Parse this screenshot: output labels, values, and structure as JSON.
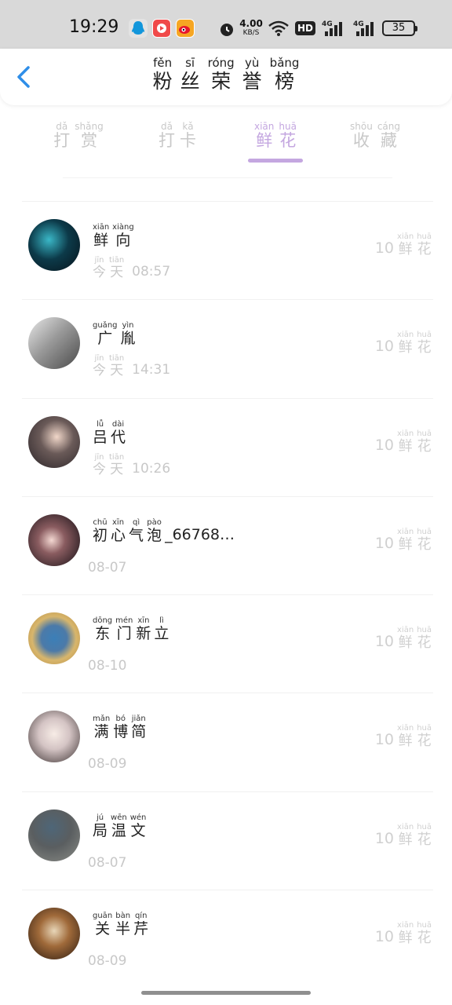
{
  "status_bar": {
    "time": "19:29",
    "network_speed": "4.00",
    "network_speed_unit": "KB/S",
    "hd_label": "HD",
    "signal1_label": "4G",
    "signal2_label": "4G",
    "battery": "35",
    "apps": [
      "qq-icon",
      "video-app-icon",
      "weibo-icon"
    ]
  },
  "header": {
    "title": [
      {
        "py": "fěn",
        "hz": "粉"
      },
      {
        "py": "sī",
        "hz": "丝"
      },
      {
        "py": "róng",
        "hz": "荣"
      },
      {
        "py": "yù",
        "hz": "誉"
      },
      {
        "py": "bǎng",
        "hz": "榜"
      }
    ]
  },
  "tabs": [
    {
      "chars": [
        {
          "py": "dǎ",
          "hz": "打"
        },
        {
          "py": "shǎng",
          "hz": "赏"
        }
      ],
      "active": false
    },
    {
      "chars": [
        {
          "py": "dǎ",
          "hz": "打"
        },
        {
          "py": "kǎ",
          "hz": "卡"
        }
      ],
      "active": false
    },
    {
      "chars": [
        {
          "py": "xiān",
          "hz": "鲜"
        },
        {
          "py": "huā",
          "hz": "花"
        }
      ],
      "active": true
    },
    {
      "chars": [
        {
          "py": "shōu",
          "hz": "收"
        },
        {
          "py": "cáng",
          "hz": "藏"
        }
      ],
      "active": false
    }
  ],
  "colors": {
    "accent": "#c4a7e0",
    "muted_text": "#c8c8c8",
    "back_arrow": "#2f8ee8"
  },
  "gift": {
    "count": "10",
    "chars": [
      {
        "py": "xiān",
        "hz": "鲜"
      },
      {
        "py": "huā",
        "hz": "花"
      }
    ]
  },
  "today_label": [
    {
      "py": "jīn",
      "hz": "今"
    },
    {
      "py": "tiān",
      "hz": "天"
    }
  ],
  "fans": [
    {
      "name": [
        {
          "py": "xiān",
          "hz": "鲜"
        },
        {
          "py": "xiàng",
          "hz": "向"
        }
      ],
      "suffix": "",
      "today": true,
      "time": "08:57"
    },
    {
      "name": [
        {
          "py": "guǎng",
          "hz": "广"
        },
        {
          "py": "yìn",
          "hz": "胤"
        }
      ],
      "suffix": "",
      "today": true,
      "time": "14:31"
    },
    {
      "name": [
        {
          "py": "lǚ",
          "hz": "吕"
        },
        {
          "py": "dài",
          "hz": "代"
        }
      ],
      "suffix": "",
      "today": true,
      "time": "10:26"
    },
    {
      "name": [
        {
          "py": "chū",
          "hz": "初"
        },
        {
          "py": "xīn",
          "hz": "心"
        },
        {
          "py": "qì",
          "hz": "气"
        },
        {
          "py": "pào",
          "hz": "泡"
        }
      ],
      "suffix": "_66768…",
      "today": false,
      "time": "08-07"
    },
    {
      "name": [
        {
          "py": "dōng",
          "hz": "东"
        },
        {
          "py": "mén",
          "hz": "门"
        },
        {
          "py": "xīn",
          "hz": "新"
        },
        {
          "py": "lì",
          "hz": "立"
        }
      ],
      "suffix": "",
      "today": false,
      "time": "08-10"
    },
    {
      "name": [
        {
          "py": "mǎn",
          "hz": "满"
        },
        {
          "py": "bó",
          "hz": "博"
        },
        {
          "py": "jiǎn",
          "hz": "简"
        }
      ],
      "suffix": "",
      "today": false,
      "time": "08-09"
    },
    {
      "name": [
        {
          "py": "jú",
          "hz": "局"
        },
        {
          "py": "wēn",
          "hz": "温"
        },
        {
          "py": "wén",
          "hz": "文"
        }
      ],
      "suffix": "",
      "today": false,
      "time": "08-07"
    },
    {
      "name": [
        {
          "py": "guān",
          "hz": "关"
        },
        {
          "py": "bàn",
          "hz": "半"
        },
        {
          "py": "qín",
          "hz": "芹"
        }
      ],
      "suffix": "",
      "today": false,
      "time": "08-09"
    }
  ]
}
